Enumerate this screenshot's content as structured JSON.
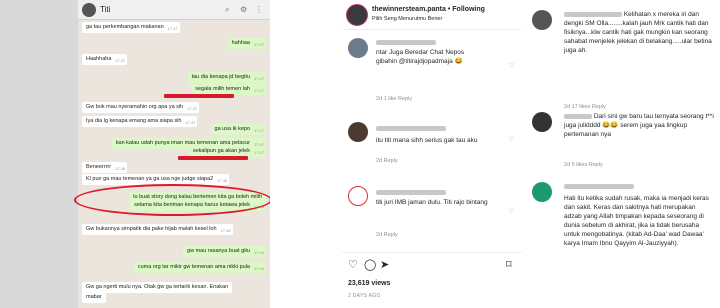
{
  "whatsapp": {
    "contact_name": "Titi",
    "messages": [
      {
        "dir": "in",
        "text": "ga tau perkembangan makanan",
        "time": "17.47"
      },
      {
        "dir": "out",
        "text": "hahhaa",
        "time": "17.47"
      },
      {
        "dir": "in",
        "text": "Haahhaha",
        "time": "17.47"
      },
      {
        "dir": "out",
        "text": "tau dia kenapa jd begitu",
        "time": "17.47"
      },
      {
        "dir": "out",
        "text": "segala milih temen lah",
        "time": "17.47"
      },
      {
        "dir": "in",
        "text": "Gw bok mau nyeramahin org apa ya sih",
        "time": "17.47"
      },
      {
        "dir": "in",
        "text": "Iya dia lg kenapa emang ama siapa sih",
        "time": "17.47"
      },
      {
        "dir": "out",
        "text": "ga usa ik kepo",
        "time": "17.47"
      },
      {
        "dir": "out",
        "text": "kan kalau udah punya iman mau temenan ama pelacur",
        "time": "17.47"
      },
      {
        "dir": "out",
        "text": "sekalipun ga akan jelek",
        "time": "17.47"
      },
      {
        "dir": "in",
        "text": "Beneerrrrr",
        "time": "17.48"
      },
      {
        "dir": "in",
        "text": "Kl pun ga mau temenan ya ga usa nge judge siapa2",
        "time": "17.48"
      },
      {
        "dir": "out",
        "text": "lu buat story dong kalau bertemen kita ga boleh milih",
        "time": ""
      },
      {
        "dir": "out",
        "text": "selama kita beriman kenapa harus ketawa jelek",
        "time": "17.48"
      },
      {
        "dir": "in",
        "text": "Gw bukannya simpatik dia pake hijab malah kesel loh",
        "time": "17.48"
      },
      {
        "dir": "out",
        "text": "gw mau rasanya buat gitu",
        "time": "17.49"
      },
      {
        "dir": "out",
        "text": "cuma org tar mikir gw temenan ama nikki pula",
        "time": "17.49"
      },
      {
        "dir": "in",
        "text": "Gw ga ngerti mulu nya. Otak gw ga tertarik kesan. Enakan",
        "time": ""
      },
      {
        "dir": "in",
        "text": "mabar",
        "time": ""
      }
    ]
  },
  "post": {
    "username": "thewinnersteam.panta",
    "following": "• Following",
    "subtitle": "Pilih Seng Menurutmu Bener",
    "comments": [
      {
        "text": "ntar Juga Beredar Chat Nepos gibahin @titirajdjopadmaja 😂",
        "meta": "2d  1 like   Reply"
      },
      {
        "text": "itu titi mana sihh serius gak tau aku",
        "meta": "2d   Reply"
      },
      {
        "text": "titi juri IMB jaman dulu. Titi rajo bintang",
        "meta": "2d   Reply"
      }
    ],
    "likes": "23,619 views",
    "date": "2 DAYS AGO"
  },
  "right_comments": [
    {
      "text": "Kelihatan x mereka iri dan dengki SM Olla........kalah jauh Mrk cantik hati dan fisiknya...klw cantik hati gak mungkin kan seorang sahabat menjelek jelekan di belakang.....ular betina juga ah.",
      "meta": "2d   17 likes   Reply"
    },
    {
      "text": "Dari sini gw baru tau ternyata seorang t**i juga julidddd 😂😂 serem juga yaa lingkup pertemanan nya",
      "meta": "2d   5 likes   Reply"
    },
    {
      "text": "Hati itu ketika sudah rusak, maka ia menjadi keras dan sakit. Keras dan sakitnya hati merupakan adzab yang Allah timpakan kepada seseorang di dunia sebelum di akhirat, jika ia tidak berusaha untuk mengobatinya. (kitab Ad-Daa' wad Dawaa' karya Imam Ibnu Qayyim Al-Jauziyyah).",
      "meta": ""
    }
  ],
  "colors": {
    "wa_out": "#dcf8c6",
    "wa_bg": "#ece5dd",
    "highlight": "#e0192a"
  }
}
